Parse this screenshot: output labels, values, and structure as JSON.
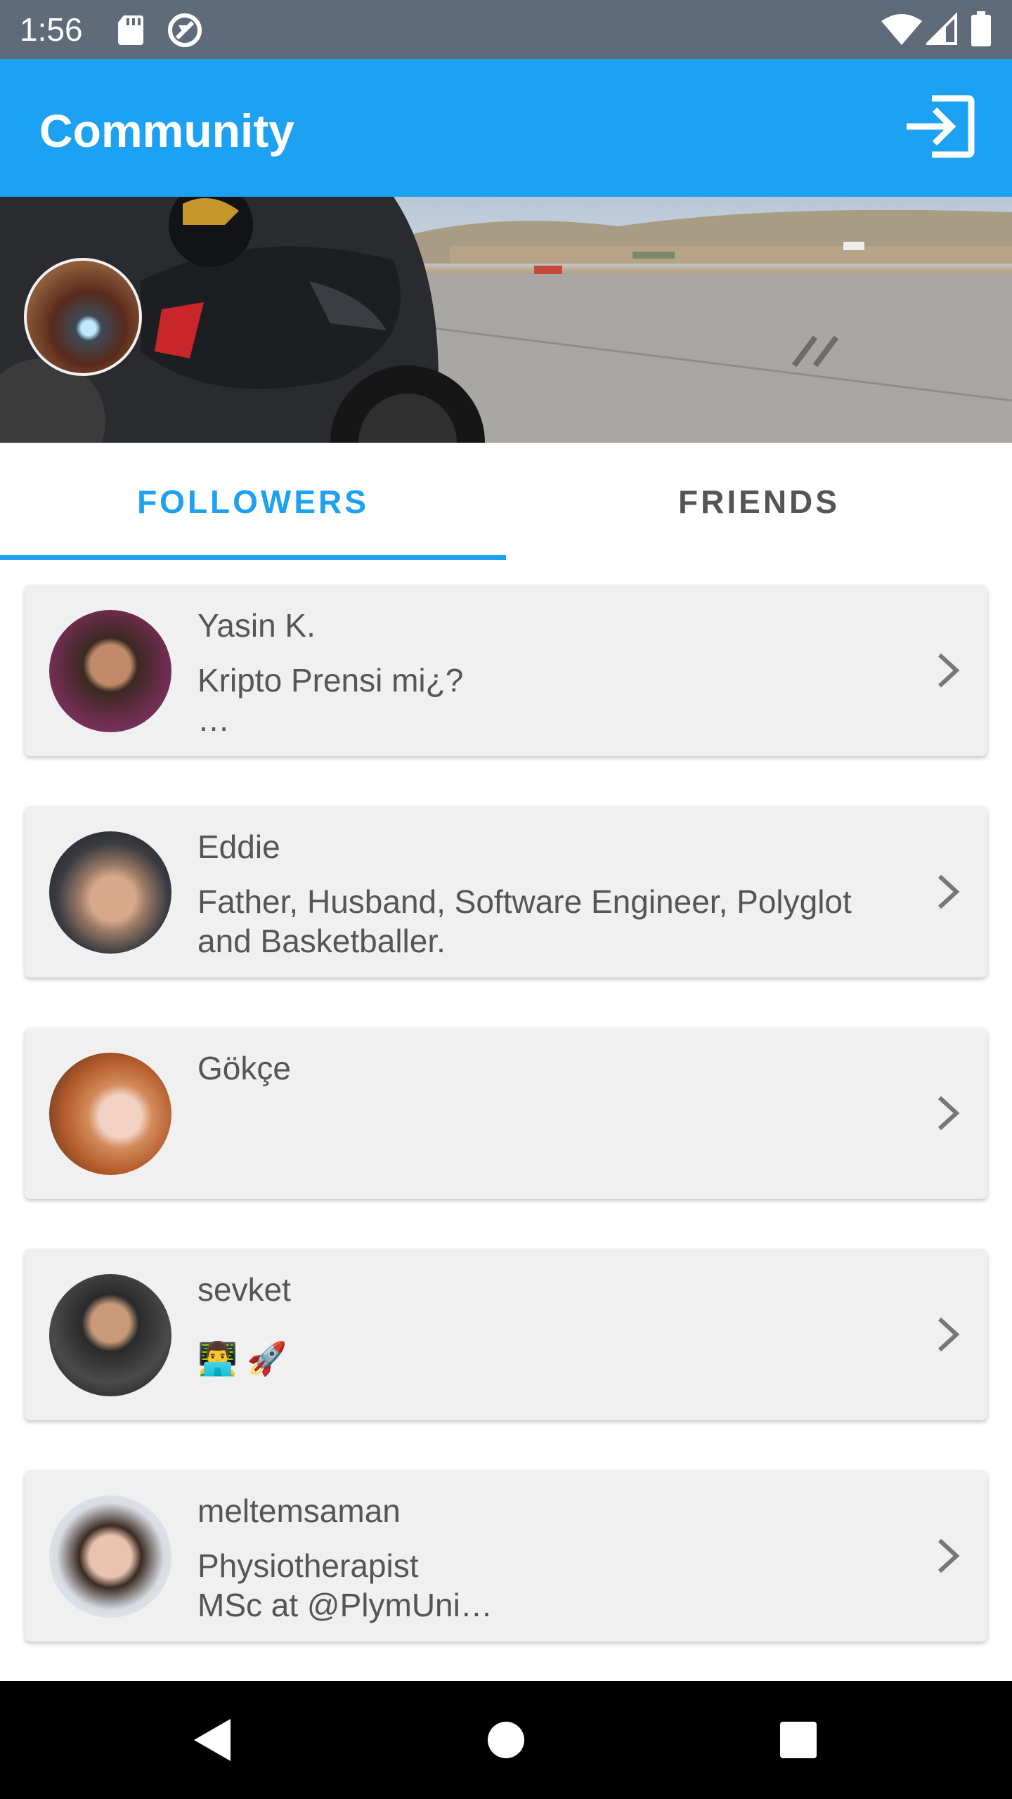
{
  "status_bar": {
    "time": "1:56",
    "icons": [
      "sd-card-icon",
      "data-saver-icon",
      "wifi-icon",
      "signal-icon",
      "battery-icon"
    ]
  },
  "app_bar": {
    "title": "Community",
    "action_icon": "login-icon",
    "color": "#1da1f2"
  },
  "tabs": [
    {
      "label": "FOLLOWERS",
      "active": true
    },
    {
      "label": "FRIENDS",
      "active": false
    }
  ],
  "followers": [
    {
      "name": "Yasin K.",
      "bio": "Kripto Prensi mi¿?\n…"
    },
    {
      "name": "Eddie",
      "bio": "Father, Husband, Software Engineer, Polyglot and Basketballer."
    },
    {
      "name": "Gökçe",
      "bio": ""
    },
    {
      "name": "sevket",
      "bio": "👨‍💻 🚀"
    },
    {
      "name": "meltemsaman",
      "bio": "Physiotherapist\nMSc at @PlymUni…"
    }
  ],
  "nav_bar": {
    "icons": [
      "back-icon",
      "home-icon",
      "recents-icon"
    ]
  },
  "colors": {
    "accent": "#1da1f2",
    "status_bar": "#5f6b78",
    "card_bg": "#f0f0f0",
    "text": "#555555"
  }
}
